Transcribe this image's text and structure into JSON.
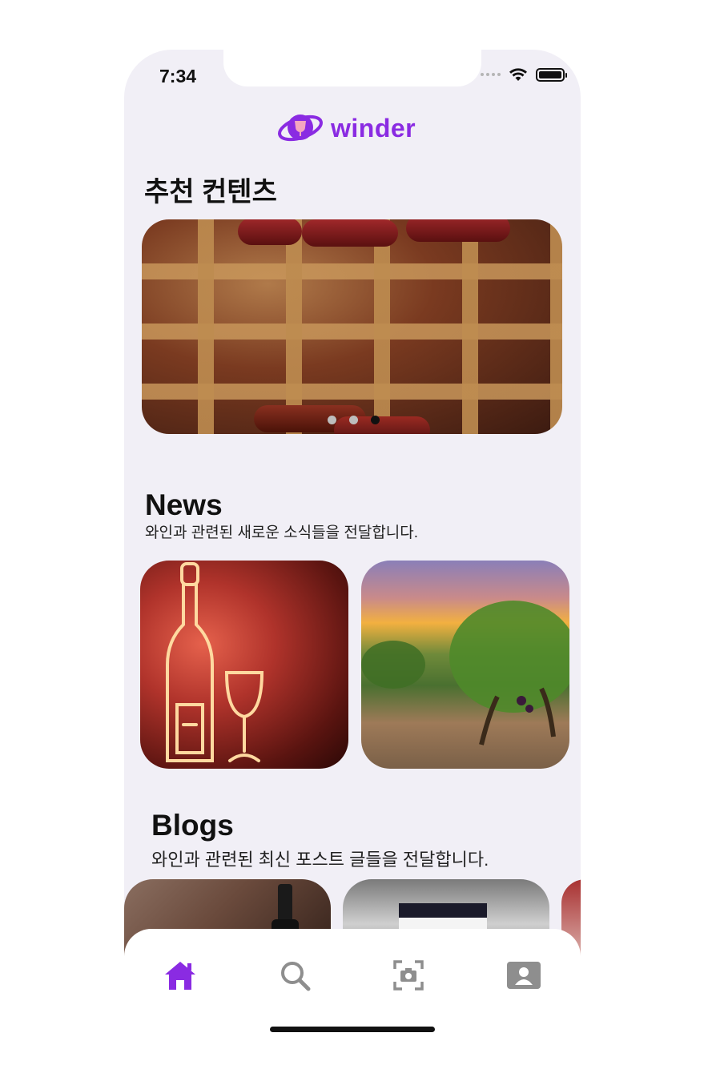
{
  "status_bar": {
    "time": "7:34"
  },
  "app": {
    "name": "winder",
    "brand_color": "#8a2be2"
  },
  "recommended": {
    "title": "추천 컨텐츠",
    "carousel": {
      "page_count": 3,
      "active_index": 2
    }
  },
  "news": {
    "title": "News",
    "subtitle": "와인과 관련된 새로운 소식들을 전달합니다.",
    "cards": [
      {
        "image": "neon-wine-bottle-sign"
      },
      {
        "image": "vineyard-sunset"
      }
    ]
  },
  "blogs": {
    "title": "Blogs",
    "subtitle": "와인과 관련된 최신 포스트 글들을 전달합니다.",
    "cards": [
      {
        "image": "wine-bottle-brick-wall"
      },
      {
        "image": "wine-bottle-glasses"
      },
      {
        "image": "berries"
      }
    ]
  },
  "tab_bar": {
    "active": "home",
    "items": [
      {
        "id": "home",
        "icon": "home-icon",
        "color": "#8a2be2"
      },
      {
        "id": "search",
        "icon": "search-icon",
        "color": "#8e8e8e"
      },
      {
        "id": "camera",
        "icon": "camera-scan-icon",
        "color": "#8e8e8e"
      },
      {
        "id": "profile",
        "icon": "profile-icon",
        "color": "#8e8e8e"
      }
    ]
  }
}
